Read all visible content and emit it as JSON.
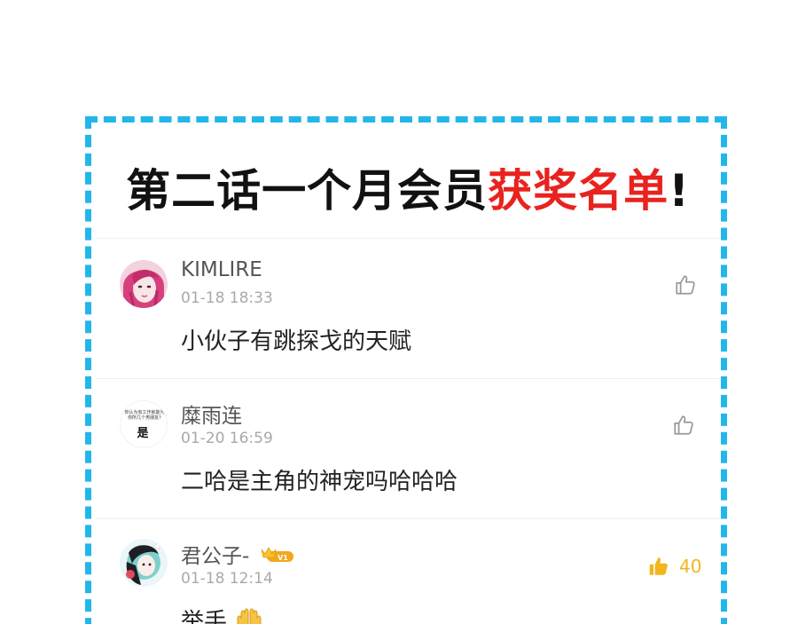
{
  "title": {
    "part1": "第二话一个月会员",
    "part2": "获奖名单",
    "suffix": "!"
  },
  "colors": {
    "frame": "#23b6ea",
    "title_accent": "#e8231f",
    "like_active": "#f2b51d"
  },
  "comments": [
    {
      "username": "KIMLIRE",
      "time": "01-18 18:33",
      "text": "小伙子有跳探戈的天赋",
      "like_icon": "thumbs-up-outline-icon",
      "like_count": ""
    },
    {
      "username": "糜雨连",
      "time": "01-20 16:59",
      "text": "二哈是主角的神宠吗哈哈哈",
      "avatar_text_small": "你认为有工作就能为\n你所几个男朋友?",
      "avatar_text_big": "是",
      "like_icon": "thumbs-up-outline-icon",
      "like_count": ""
    },
    {
      "username": "君公子-",
      "badge": "V1",
      "time": "01-18 12:14",
      "text": "举手",
      "like_icon": "thumbs-up-filled-icon",
      "like_count": "40"
    }
  ]
}
